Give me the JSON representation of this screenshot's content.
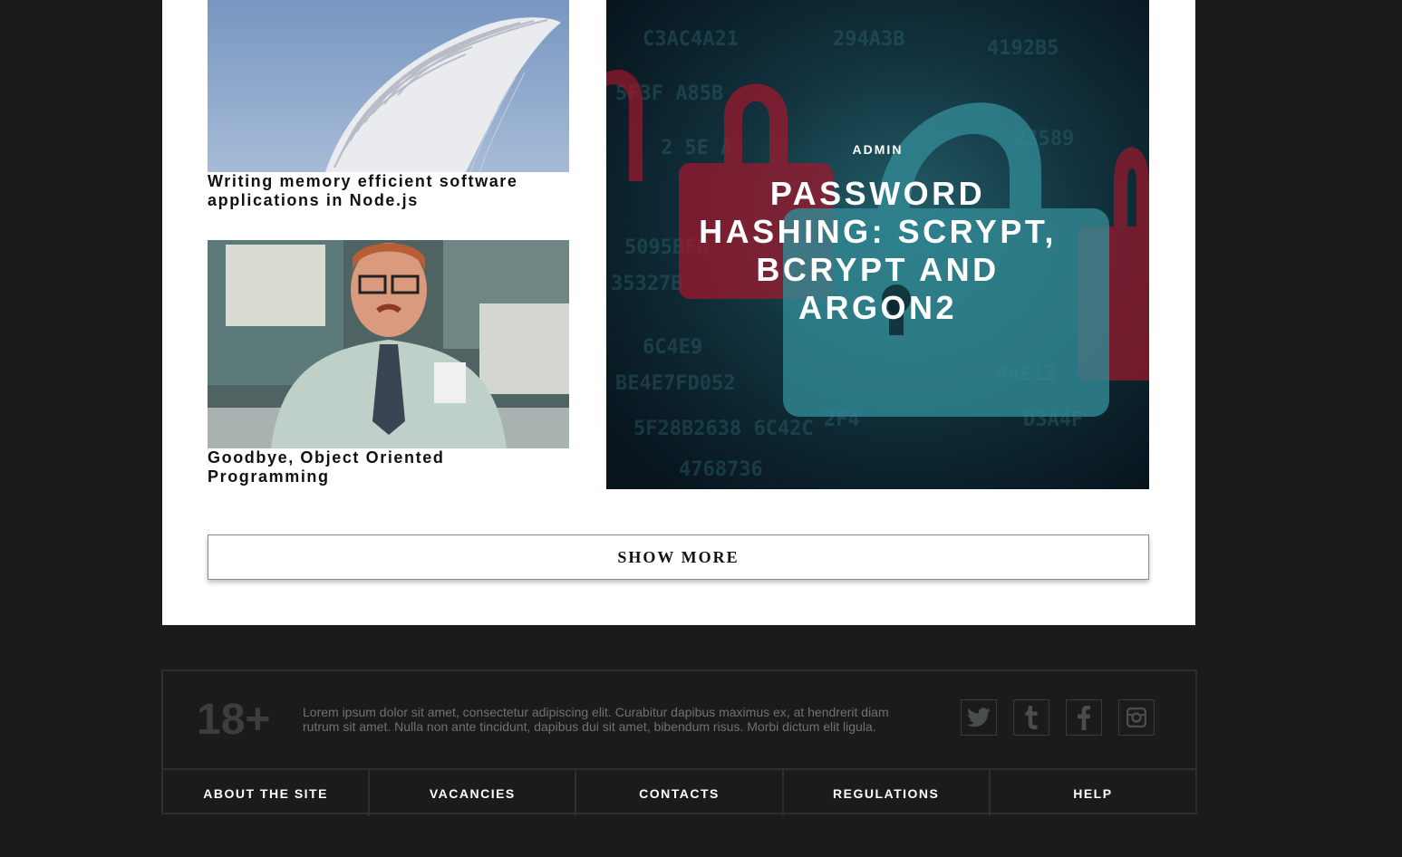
{
  "posts": [
    {
      "title": "Writing memory efficient software applications in Node.js"
    },
    {
      "title": "Goodbye, Object Oriented Programming"
    }
  ],
  "featured": {
    "author": "ADMIN",
    "title": "Password Hashing: Scrypt, Bcrypt and ARGON2"
  },
  "show_more_label": "SHOW MORE",
  "footer": {
    "age": "18+",
    "text": "Lorem ipsum dolor sit amet, consectetur adipiscing elit. Curabitur dapibus maximus ex, at hendrerit diam rutrum sit amet. Nulla non ante tincidunt, dapibus dui sit amet, bibendum risus. Morbi dictum elit ligula.",
    "socials": [
      "twitter-icon",
      "tumblr-icon",
      "facebook-icon",
      "instagram-icon"
    ],
    "nav": [
      "ABOUT THE SITE",
      "VACANCIES",
      "CONTACTS",
      "REGULATIONS",
      "HELP"
    ]
  },
  "colors": {
    "background": "#1a1c1c",
    "content": "#ffffff",
    "border": "#2c2f2f",
    "accent_red": "#c0203a",
    "accent_teal": "#2c8a97"
  }
}
